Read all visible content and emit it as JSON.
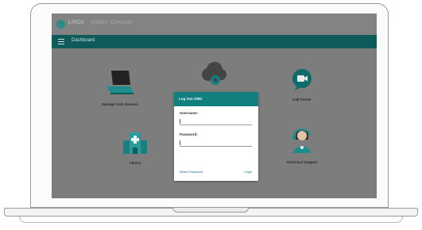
{
  "app": {
    "brand": "LifIDx",
    "brand_sub": "Admin Console"
  },
  "navbar": {
    "title": "Dashboard"
  },
  "tiles": [
    {
      "label": "Manage Safe Devices",
      "icon": "laptop-icon"
    },
    {
      "label": "",
      "icon": "cloud-gear-icon"
    },
    {
      "label": "Call Center",
      "icon": "video-chat-icon"
    },
    {
      "label": "Clinics",
      "icon": "hospital-building-icon"
    },
    {
      "label": "Technical Support",
      "icon": "support-agent-icon"
    }
  ],
  "login": {
    "title": "Log into OMD",
    "username_label": "Username:",
    "username_value": "",
    "password_label": "Password:",
    "password_value": "",
    "reset_link": "Reset Password",
    "login_link": "Login"
  },
  "colors": {
    "teal": "#138080",
    "teal_dark": "#0f5b5b",
    "overlay_gray": "#7d7d7d"
  }
}
